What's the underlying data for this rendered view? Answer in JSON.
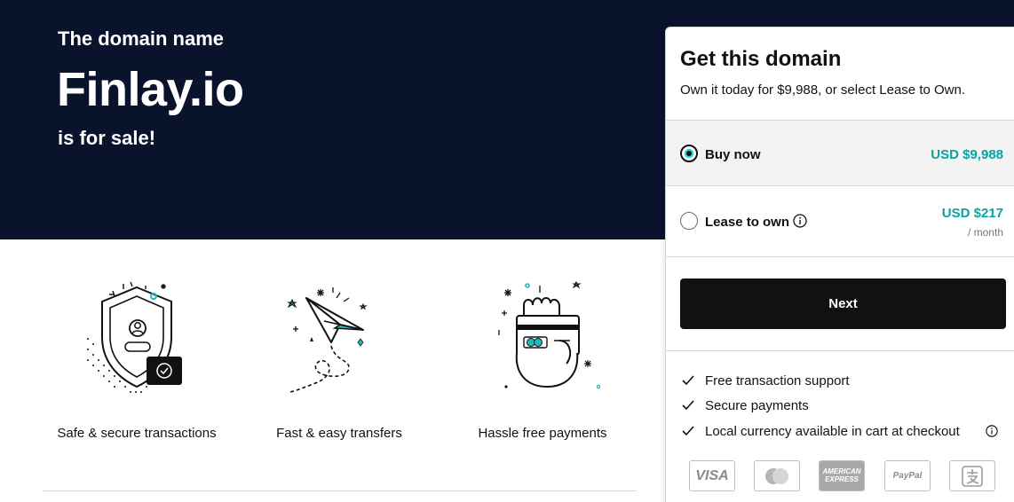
{
  "hero": {
    "subtitle": "The domain name",
    "domain": "Finlay.io",
    "sale_text": "is for sale!",
    "background": "#09142c"
  },
  "features": [
    {
      "label": "Safe & secure transactions",
      "icon": "shield-user-icon"
    },
    {
      "label": "Fast & easy transfers",
      "icon": "paper-plane-icon"
    },
    {
      "label": "Hassle free payments",
      "icon": "hand-card-icon"
    }
  ],
  "purchase": {
    "title": "Get this domain",
    "description": "Own it today for $9,988, or select Lease to Own.",
    "options": [
      {
        "label": "Buy now",
        "price": "USD $9,988",
        "selected": true
      },
      {
        "label": "Lease to own",
        "price": "USD $217",
        "period": "/ month",
        "selected": false
      }
    ],
    "next_label": "Next",
    "benefits": [
      "Free transaction support",
      "Secure payments",
      "Local currency available in cart at checkout"
    ],
    "payment_methods": [
      {
        "name": "VISA",
        "icon": "visa-icon"
      },
      {
        "name": "Mastercard",
        "icon": "mastercard-icon"
      },
      {
        "name": "AMERICAN EXPRESS",
        "icon": "amex-icon"
      },
      {
        "name": "PayPal",
        "icon": "paypal-icon"
      },
      {
        "name": "Alipay",
        "icon": "alipay-icon"
      }
    ],
    "accent_color": "#09a3a3",
    "button_color": "#111111"
  }
}
